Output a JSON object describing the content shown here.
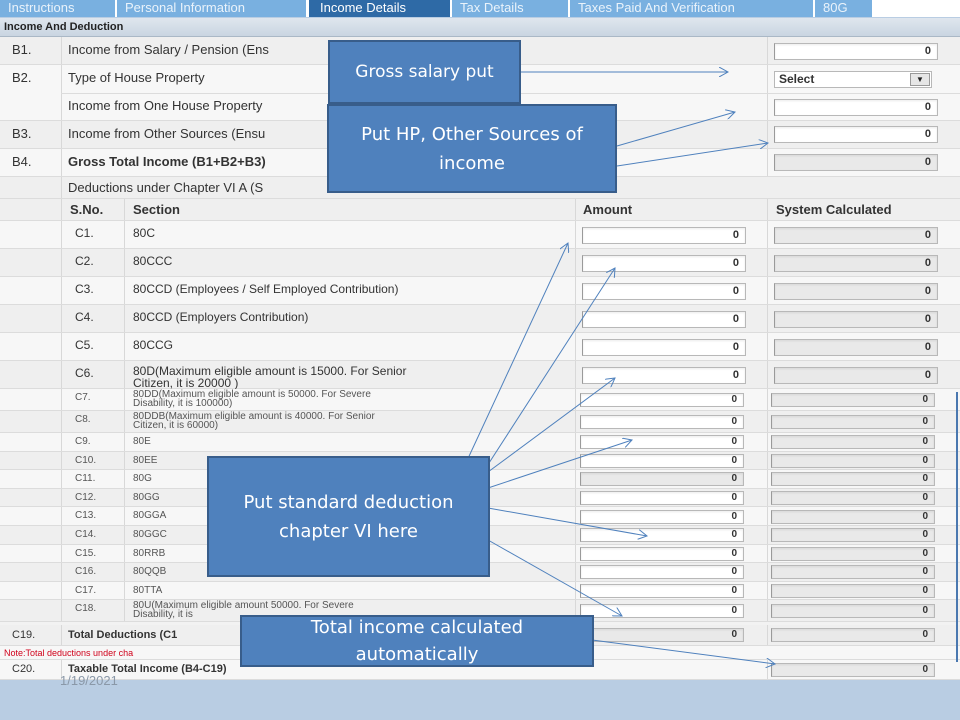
{
  "tabs": [
    {
      "label": "Instructions",
      "active": false
    },
    {
      "label": "Personal Information",
      "active": false
    },
    {
      "label": "Income Details",
      "active": true
    },
    {
      "label": "Tax Details",
      "active": false
    },
    {
      "label": "Taxes Paid And Verification",
      "active": false
    },
    {
      "label": "80G",
      "active": false
    }
  ],
  "section_title": "Income And Deduction",
  "income": {
    "b1": {
      "code": "B1.",
      "label": "Income from Salary / Pension (Ens",
      "value": "0"
    },
    "b2": {
      "code": "B2.",
      "label": "Type of House Property",
      "select": "Select"
    },
    "b2b": {
      "label": "Income from One House Property",
      "value": "0"
    },
    "b3": {
      "code": "B3.",
      "label": "Income from Other Sources (Ensu",
      "value": "0"
    },
    "b4": {
      "code": "B4.",
      "label": "Gross Total Income (B1+B2+B3)",
      "value": "0"
    },
    "deductions_label": "Deductions under Chapter VI A (S"
  },
  "deductions_table": {
    "headers": {
      "sno": "S.No.",
      "section": "Section",
      "amount": "Amount",
      "system": "System Calculated"
    },
    "rows": [
      {
        "sno": "C1.",
        "section": "80C",
        "amount": "0",
        "system": "0"
      },
      {
        "sno": "C2.",
        "section": "80CCC",
        "amount": "0",
        "system": "0"
      },
      {
        "sno": "C3.",
        "section": "80CCD (Employees / Self Employed Contribution)",
        "amount": "0",
        "system": "0"
      },
      {
        "sno": "C4.",
        "section": "80CCD (Employers Contribution)",
        "amount": "0",
        "system": "0"
      },
      {
        "sno": "C5.",
        "section": "80CCG",
        "amount": "0",
        "system": "0"
      },
      {
        "sno": "C6.",
        "section": "80D(Maximum eligible amount is 15000. For Senior",
        "section2": "Citizen, it is 20000 )",
        "amount": "0",
        "system": "0"
      },
      {
        "sno": "C7.",
        "section": "80DD(Maximum eligible amount is 50000. For Severe",
        "section2": "Disability, it is 100000)",
        "amount": "0",
        "system": "0"
      },
      {
        "sno": "C8.",
        "section": "80DDB(Maximum eligible amount is 40000. For Senior",
        "section2": "Citizen, it is 60000)",
        "amount": "0",
        "system": "0"
      },
      {
        "sno": "C9.",
        "section": "80E",
        "amount": "0",
        "system": "0"
      },
      {
        "sno": "C10.",
        "section": "80EE",
        "amount": "0",
        "system": "0"
      },
      {
        "sno": "C11.",
        "section": "80G",
        "amount": "0",
        "system": "0"
      },
      {
        "sno": "C12.",
        "section": "80GG",
        "amount": "0",
        "system": "0"
      },
      {
        "sno": "C13.",
        "section": "80GGA",
        "amount": "0",
        "system": "0"
      },
      {
        "sno": "C14.",
        "section": "80GGC",
        "amount": "0",
        "system": "0"
      },
      {
        "sno": "C15.",
        "section": "80RRB",
        "amount": "0",
        "system": "0"
      },
      {
        "sno": "C16.",
        "section": "80QQB",
        "amount": "0",
        "system": "0"
      },
      {
        "sno": "C17.",
        "section": "80TTA",
        "amount": "0",
        "system": "0"
      },
      {
        "sno": "C18.",
        "section": "80U(Maximum eligible amount 50000. For Severe",
        "section2": "Disability, it is",
        "amount": "0",
        "system": "0"
      }
    ],
    "c19": {
      "sno": "C19.",
      "label": "Total Deductions (C1",
      "amount": "0",
      "system": "0"
    },
    "note": "Note:Total deductions under cha",
    "c20": {
      "sno": "C20.",
      "label": "Taxable Total Income (B4-C19)",
      "system": "0"
    }
  },
  "callouts": {
    "gross_salary": "Gross salary put",
    "hp_other": [
      "Put HP, Other Sources of",
      "income"
    ],
    "standard_deduction": [
      "Put standard deduction",
      "chapter VI here"
    ],
    "total_income": [
      "Total income calculated",
      "automatically"
    ]
  },
  "footer_date": "1/19/2021",
  "colors": {
    "tab_active": "#2e6aa6",
    "tab": "#79b0e0",
    "callout": "#4f81bd",
    "note_red": "#d0021b"
  }
}
